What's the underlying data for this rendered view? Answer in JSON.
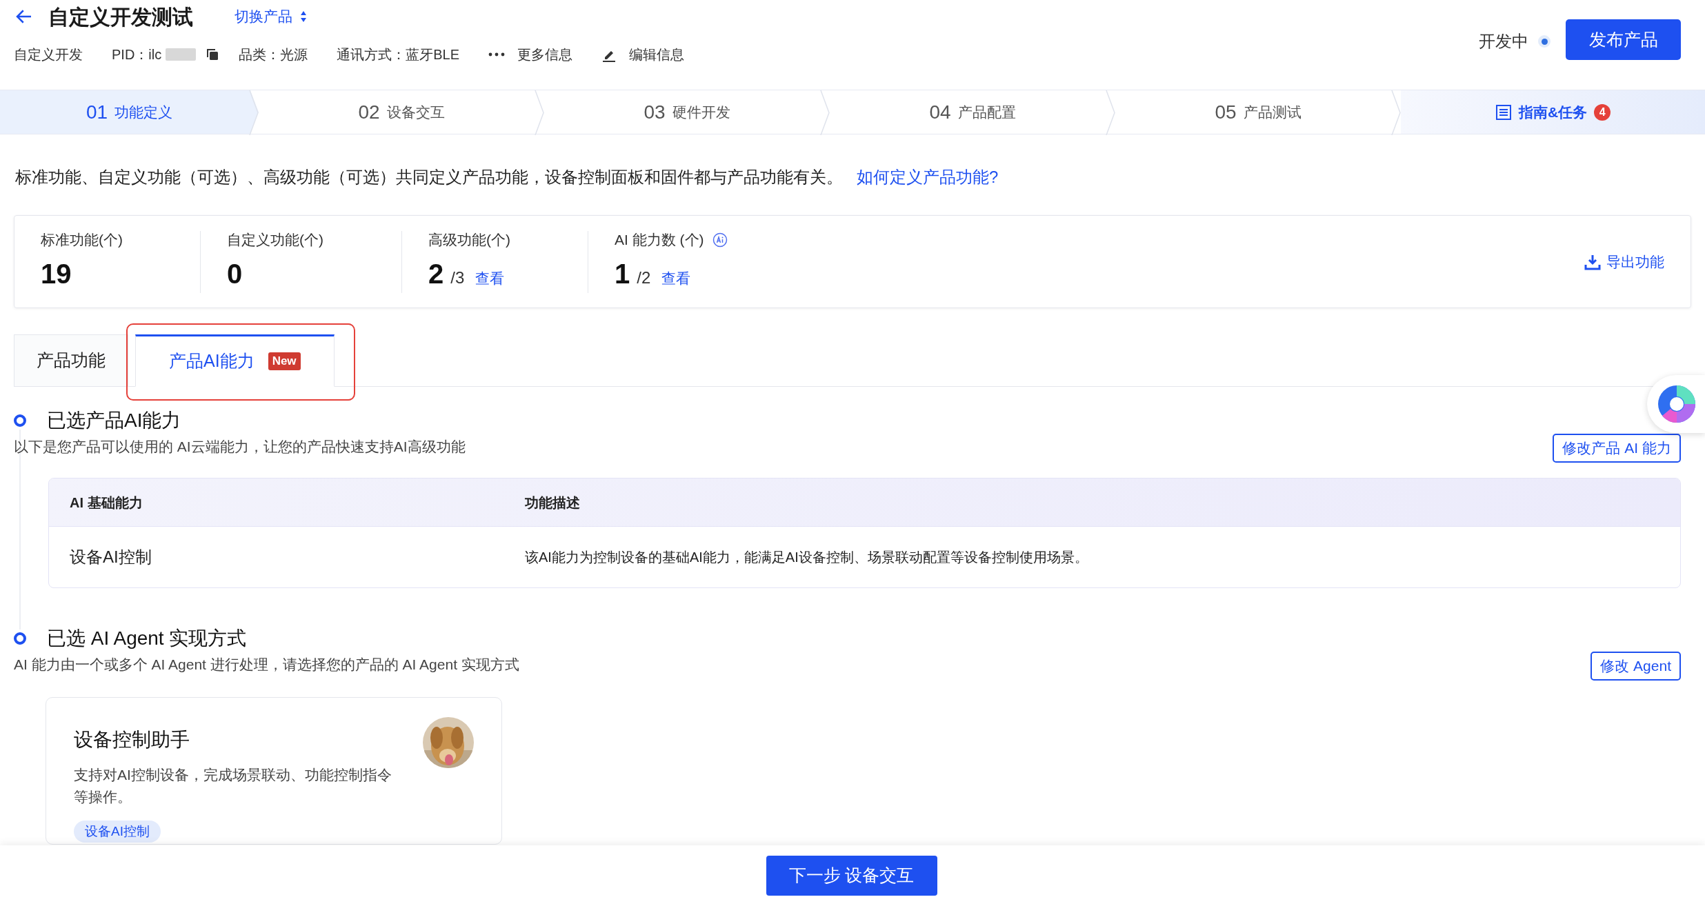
{
  "header": {
    "title": "自定义开发测试",
    "switch_label": "切换产品",
    "meta": [
      {
        "kind": "text",
        "text": "自定义开发"
      },
      {
        "kind": "pid",
        "text": "PID：ilc"
      },
      {
        "kind": "text",
        "text": "品类：光源"
      },
      {
        "kind": "text",
        "text": "通讯方式：蓝牙BLE"
      },
      {
        "kind": "more",
        "text": "更多信息"
      },
      {
        "kind": "edit",
        "text": "编辑信息"
      }
    ],
    "status": "开发中",
    "publish_button": "发布产品"
  },
  "steps": [
    {
      "number": "01",
      "label": "功能定义",
      "selected": true
    },
    {
      "number": "02",
      "label": "设备交互",
      "selected": false
    },
    {
      "number": "03",
      "label": "硬件开发",
      "selected": false
    },
    {
      "number": "04",
      "label": "产品配置",
      "selected": false
    },
    {
      "number": "05",
      "label": "产品测试",
      "selected": false
    }
  ],
  "guide": {
    "label": "指南&任务",
    "badge": "4"
  },
  "intro": {
    "text": "标准功能、自定义功能（可选）、高级功能（可选）共同定义产品功能，设备控制面板和固件都与产品功能有关。",
    "link": "如何定义产品功能?"
  },
  "stats": [
    {
      "label": "标准功能(个)",
      "value": "19"
    },
    {
      "label": "自定义功能(个)",
      "value": "0"
    },
    {
      "label": "高级功能(个)",
      "value": "2",
      "total": "/3",
      "link": "查看"
    },
    {
      "label": "AI 能力数 (个)",
      "value": "1",
      "total": "/2",
      "link": "查看",
      "ai_icon": true
    }
  ],
  "export_button": "导出功能",
  "tabs": [
    {
      "label": "产品功能",
      "selected": false
    },
    {
      "label": "产品AI能力",
      "selected": true,
      "badge": "New"
    }
  ],
  "sections": [
    {
      "kind": "table",
      "title": "已选产品AI能力",
      "description": "以下是您产品可以使用的 AI云端能力，让您的产品快速支持AI高级功能",
      "button": "修改产品 AI 能力",
      "table": {
        "columns": [
          "AI 基础能力",
          "功能描述"
        ],
        "rows": [
          [
            "设备AI控制",
            "该AI能力为控制设备的基础AI能力，能满足AI设备控制、场景联动配置等设备控制使用场景。"
          ]
        ]
      }
    },
    {
      "kind": "agents",
      "title": "已选 AI Agent 实现方式",
      "description": "AI 能力由一个或多个 AI Agent 进行处理，请选择您的产品的 AI Agent 实现方式",
      "button": "修改 Agent",
      "agents": [
        {
          "name": "设备控制助手",
          "description": "支持对AI控制设备，完成场景联动、功能控制指令等操作。",
          "tag": "设备AI控制"
        }
      ]
    }
  ],
  "footer_button": "下一步 设备交互"
}
